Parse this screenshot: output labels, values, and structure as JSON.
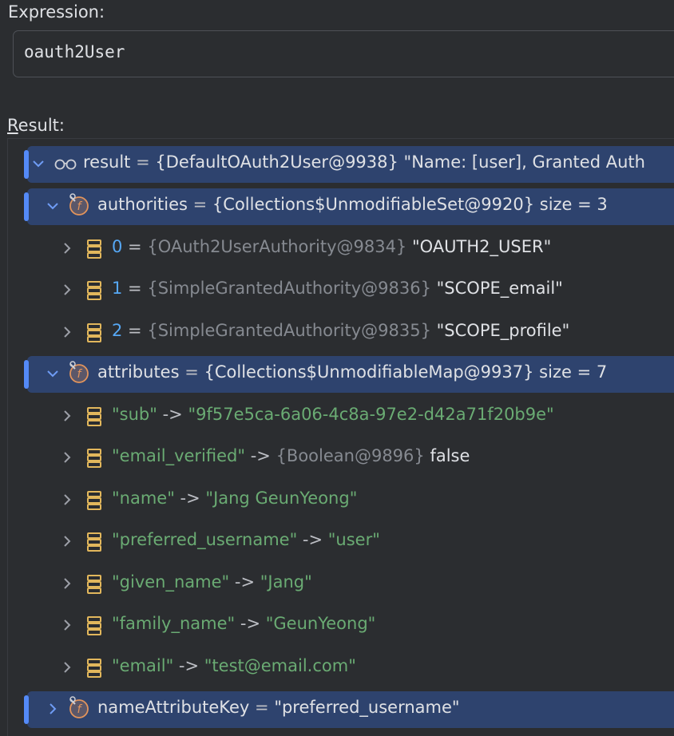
{
  "expression": {
    "label": "Expression:",
    "value": "oauth2User"
  },
  "result_label": "Result:",
  "tree": {
    "root": {
      "name": "result",
      "eq": " = ",
      "type": "{DefaultOAuth2User@9938}",
      "value": " \"Name: [user], Granted Auth"
    },
    "authorities": {
      "name": "authorities",
      "eq": " = ",
      "type": "{Collections$UnmodifiableSet@9920}",
      "size": "  size = 3",
      "items": [
        {
          "index": "0",
          "eq": " = ",
          "type": "{OAuth2UserAuthority@9834}",
          "value": " \"OAUTH2_USER\""
        },
        {
          "index": "1",
          "eq": " = ",
          "type": "{SimpleGrantedAuthority@9836}",
          "value": " \"SCOPE_email\""
        },
        {
          "index": "2",
          "eq": " = ",
          "type": "{SimpleGrantedAuthority@9835}",
          "value": " \"SCOPE_profile\""
        }
      ]
    },
    "attributes": {
      "name": "attributes",
      "eq": " = ",
      "type": "{Collections$UnmodifiableMap@9937}",
      "size": "  size = 7",
      "items": [
        {
          "key": "\"sub\"",
          "arrow": " -> ",
          "value": "\"9f57e5ca-6a06-4c8a-97e2-d42a71f20b9e\"",
          "type": ""
        },
        {
          "key": "\"email_verified\"",
          "arrow": " -> ",
          "type": "{Boolean@9896}",
          "value": " false"
        },
        {
          "key": "\"name\"",
          "arrow": " -> ",
          "value": "\"Jang GeunYeong\"",
          "type": ""
        },
        {
          "key": "\"preferred_username\"",
          "arrow": " -> ",
          "value": "\"user\"",
          "type": ""
        },
        {
          "key": "\"given_name\"",
          "arrow": " -> ",
          "value": "\"Jang\"",
          "type": ""
        },
        {
          "key": "\"family_name\"",
          "arrow": " -> ",
          "value": "\"GeunYeong\"",
          "type": ""
        },
        {
          "key": "\"email\"",
          "arrow": " -> ",
          "value": "\"test@email.com\"",
          "type": ""
        }
      ]
    },
    "nameAttributeKey": {
      "name": "nameAttributeKey",
      "eq": " = ",
      "value": "\"preferred_username\""
    }
  },
  "colors": {
    "background": "#2b2d30",
    "selection": "#2e436e",
    "focus": "#548af7",
    "string": "#6aab73",
    "type": "#868a91",
    "number": "#56a8f5",
    "field_icon": "#e2945c"
  },
  "icons": {
    "expanded": "chevron-down-icon",
    "collapsed": "chevron-right-icon",
    "watch": "glasses-icon",
    "field": "field-icon",
    "element": "array-element-icon"
  }
}
